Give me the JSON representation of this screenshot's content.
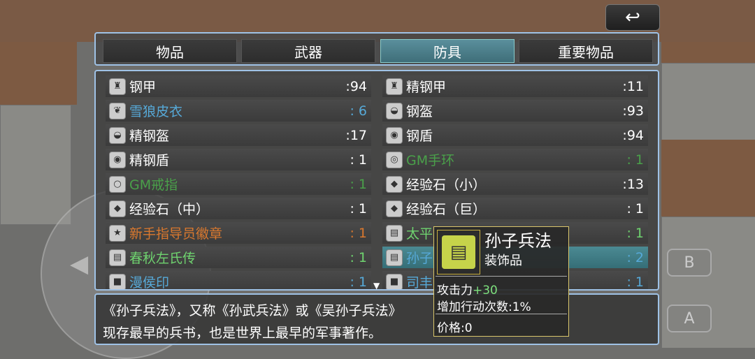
{
  "tabs": [
    {
      "label": "物品"
    },
    {
      "label": "武器"
    },
    {
      "label": "防具"
    },
    {
      "label": "重要物品"
    }
  ],
  "active_tab": "防具",
  "items_left": [
    {
      "name": "钢甲",
      "count": ":94",
      "color": "#ffffff",
      "icon": "armor-icon"
    },
    {
      "name": "雪狼皮衣",
      "count": ": 6",
      "color": "#56a9d8",
      "icon": "fur-coat-icon"
    },
    {
      "name": "精钢盔",
      "count": ":17",
      "color": "#ffffff",
      "icon": "helmet-icon"
    },
    {
      "name": "精钢盾",
      "count": ": 1",
      "color": "#ffffff",
      "icon": "shield-icon"
    },
    {
      "name": "GM戒指",
      "count": ": 1",
      "color": "#4aa04a",
      "icon": "ring-icon"
    },
    {
      "name": "经验石（中）",
      "count": ": 1",
      "color": "#ffffff",
      "icon": "exp-stone-icon"
    },
    {
      "name": "新手指导员徽章",
      "count": ": 1",
      "color": "#d9782e",
      "icon": "badge-icon"
    },
    {
      "name": "春秋左氏传",
      "count": ": 1",
      "color": "#6fd36f",
      "icon": "book-icon"
    },
    {
      "name": "漫侯印",
      "count": ": 1",
      "color": "#56a9d8",
      "icon": "seal-icon"
    }
  ],
  "items_right": [
    {
      "name": "精钢甲",
      "count": ":11",
      "color": "#ffffff",
      "icon": "armor-icon"
    },
    {
      "name": "钢盔",
      "count": ":93",
      "color": "#ffffff",
      "icon": "helmet-icon"
    },
    {
      "name": "钢盾",
      "count": ":94",
      "color": "#ffffff",
      "icon": "shield-icon"
    },
    {
      "name": "GM手环",
      "count": ": 1",
      "color": "#4aa04a",
      "icon": "bracelet-icon"
    },
    {
      "name": "经验石（小）",
      "count": ":13",
      "color": "#ffffff",
      "icon": "exp-stone-icon"
    },
    {
      "name": "经验石（巨）",
      "count": ": 1",
      "color": "#ffffff",
      "icon": "exp-stone-icon"
    },
    {
      "name": "太平",
      "count": ": 1",
      "color": "#6fd36f",
      "icon": "book-icon"
    },
    {
      "name": "孙子",
      "count": ": 2",
      "color": "#56a9d8",
      "icon": "book-icon"
    },
    {
      "name": "司丰",
      "count": ": 1",
      "color": "#56a9d8",
      "icon": "seal-icon"
    }
  ],
  "selected_item": "孙子",
  "description": {
    "line1": "《孙子兵法》，又称《孙武兵法》或《吴孙子兵法》",
    "line2": "现存最早的兵书，也是世界上最早的军事著作。"
  },
  "popup": {
    "title": "孙子兵法",
    "subtitle": "装饰品",
    "stat1_label": "攻击力",
    "stat1_value": "+30",
    "stat2_label": "增加行动次数:",
    "stat2_value": "1%",
    "price_label": "价格:",
    "price_value": "0"
  },
  "buttons": {
    "back": "↩",
    "b": "B",
    "a": "A"
  }
}
